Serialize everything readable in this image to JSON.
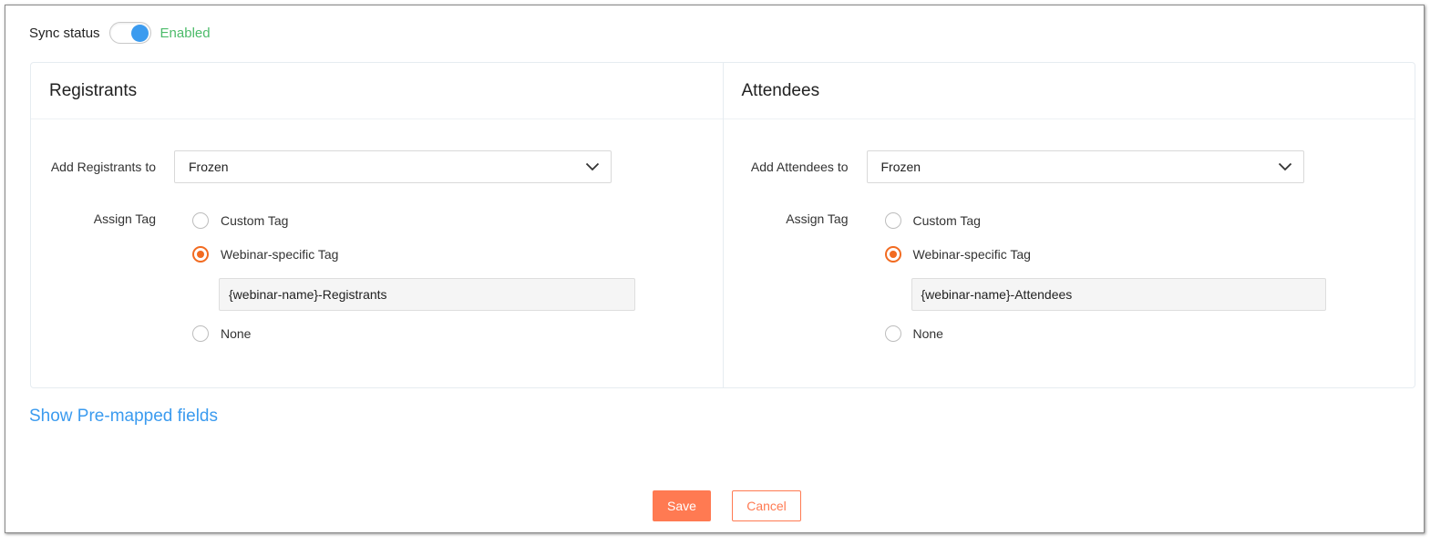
{
  "sync": {
    "label": "Sync status",
    "enabled": true,
    "state_text": "Enabled"
  },
  "registrants": {
    "title": "Registrants",
    "add_to_label": "Add Registrants to",
    "add_to_value": "Frozen",
    "assign_tag_label": "Assign Tag",
    "options": [
      {
        "label": "Custom Tag",
        "checked": false
      },
      {
        "label": "Webinar-specific Tag",
        "checked": true
      },
      {
        "label": "None",
        "checked": false
      }
    ],
    "tag_value": "{webinar-name}-Registrants"
  },
  "attendees": {
    "title": "Attendees",
    "add_to_label": "Add Attendees to",
    "add_to_value": "Frozen",
    "assign_tag_label": "Assign Tag",
    "options": [
      {
        "label": "Custom Tag",
        "checked": false
      },
      {
        "label": "Webinar-specific Tag",
        "checked": true
      },
      {
        "label": "None",
        "checked": false
      }
    ],
    "tag_value": "{webinar-name}-Attendees"
  },
  "links": {
    "show_premapped": "Show Pre-mapped fields"
  },
  "actions": {
    "save": "Save",
    "cancel": "Cancel"
  },
  "colors": {
    "accent_blue": "#3b9bef",
    "enabled_green": "#4cbb6a",
    "radio_orange": "#f26b21",
    "button_orange": "#ff7a52"
  }
}
